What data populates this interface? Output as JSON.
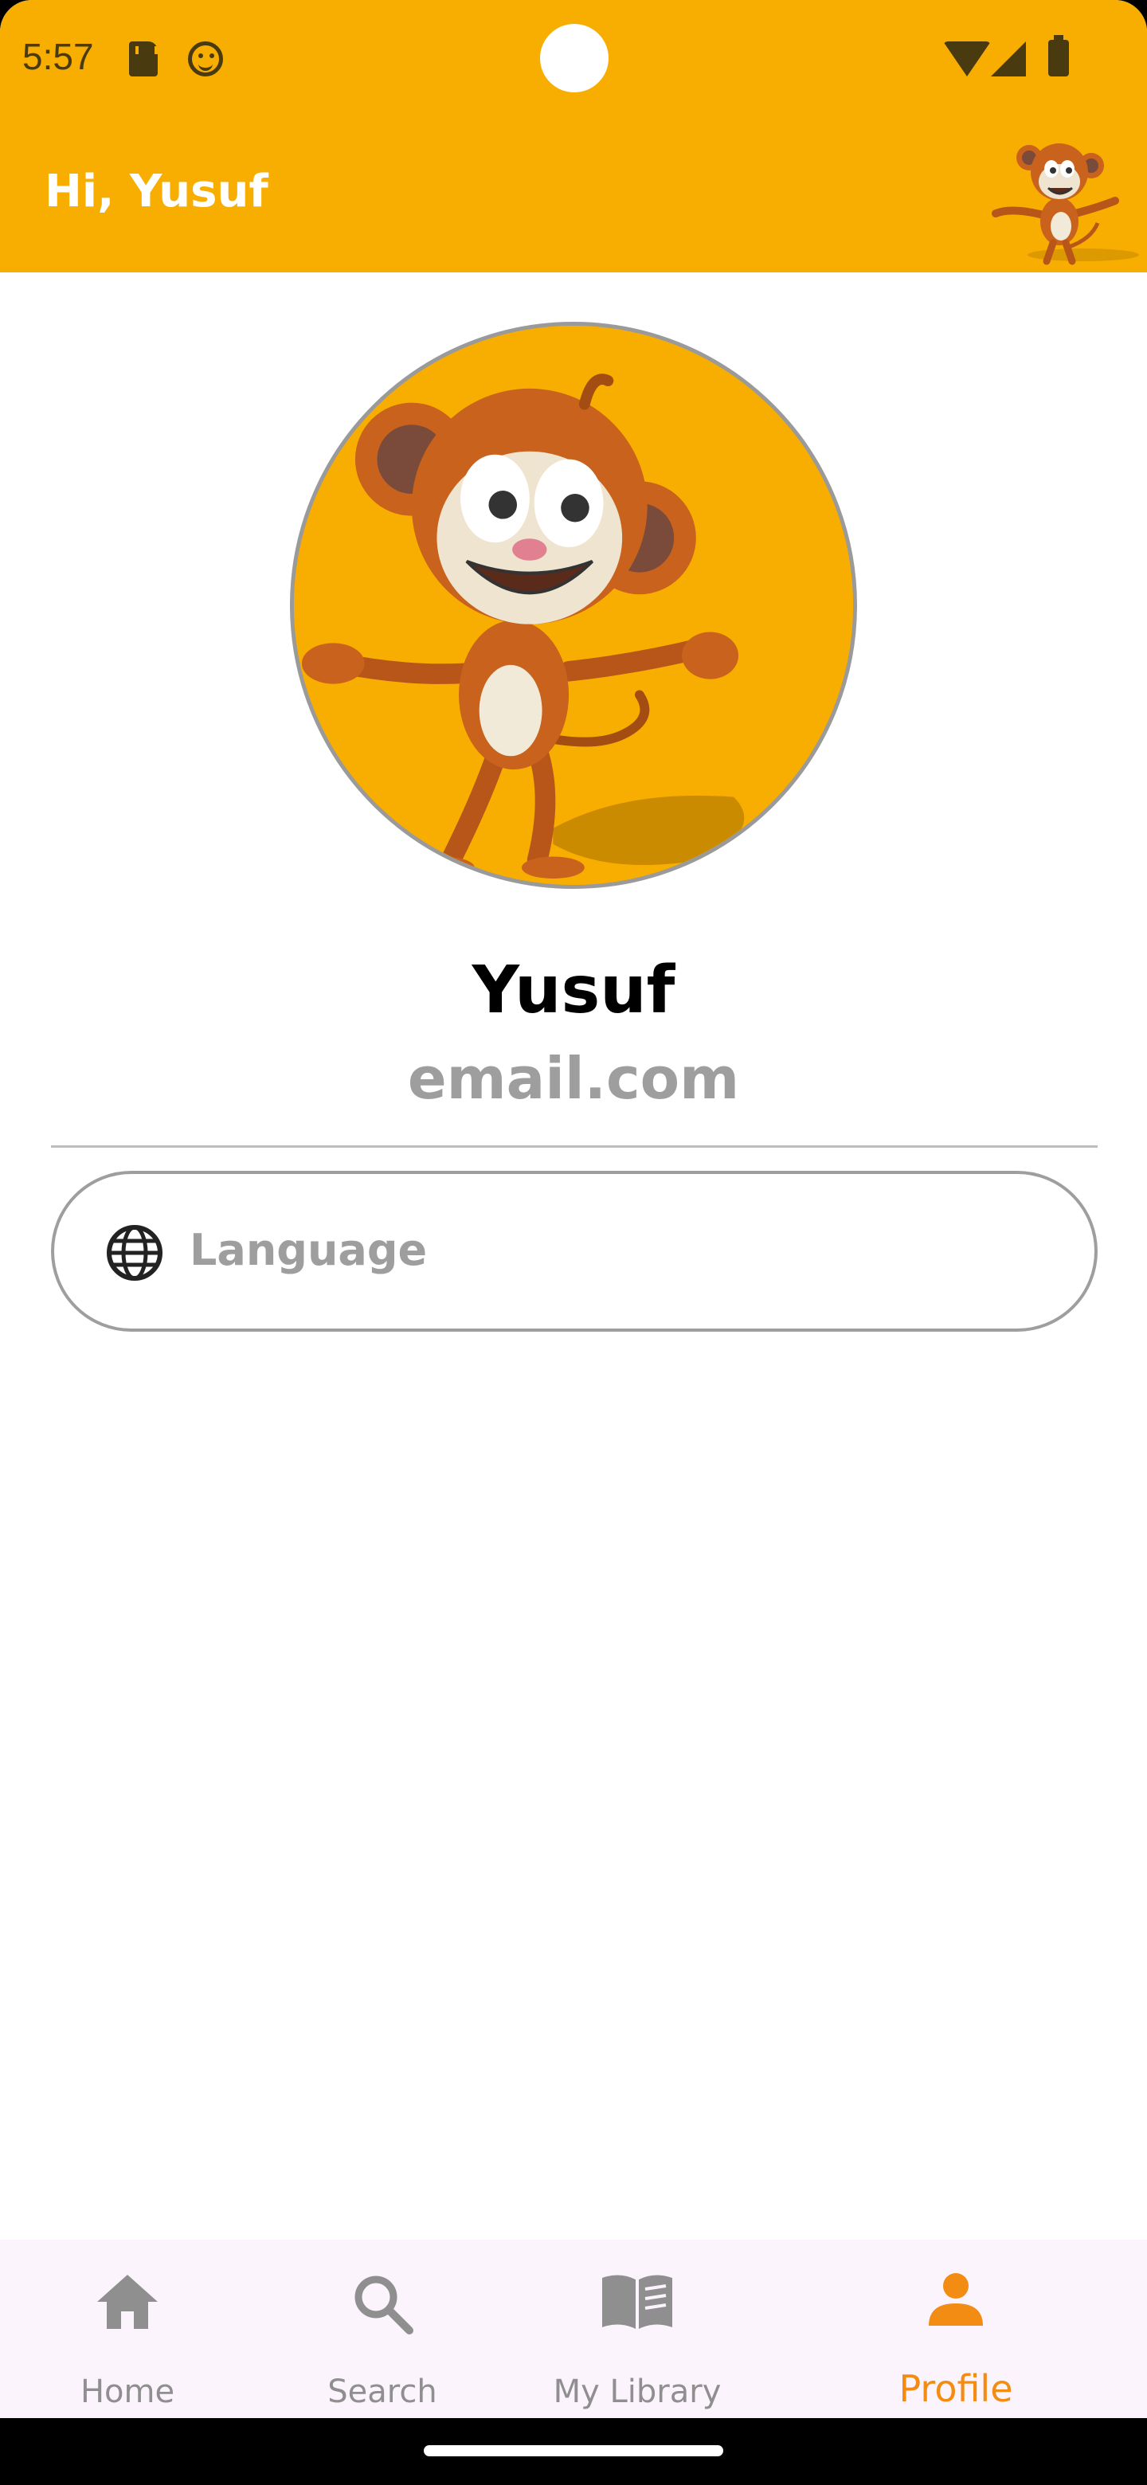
{
  "status_bar": {
    "time": "5:57"
  },
  "header": {
    "greeting": "Hi, Yusuf",
    "background_color": "#f8ae00"
  },
  "profile": {
    "name": "Yusuf",
    "email": "email.com",
    "avatar_icon": "monkey-mascot"
  },
  "settings": {
    "language_label": "Language",
    "language_icon": "globe-icon"
  },
  "bottom_nav": {
    "items": [
      {
        "label": "Home",
        "icon": "home-icon",
        "active": false
      },
      {
        "label": "Search",
        "icon": "search-icon",
        "active": false
      },
      {
        "label": "My Library",
        "icon": "book-icon",
        "active": false
      },
      {
        "label": "Profile",
        "icon": "person-icon",
        "active": true
      }
    ],
    "active_color": "#f28c13",
    "inactive_color": "#8f8f8f"
  }
}
